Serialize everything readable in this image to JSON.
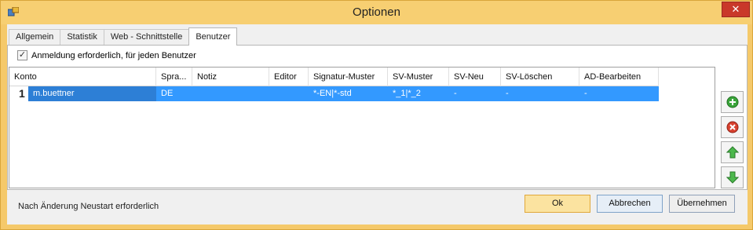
{
  "window": {
    "title": "Optionen",
    "close_glyph": "✕"
  },
  "tabs": [
    {
      "label": "Allgemein"
    },
    {
      "label": "Statistik"
    },
    {
      "label": "Web - Schnittstelle"
    },
    {
      "label": "Benutzer",
      "active": true
    }
  ],
  "login_required": {
    "label": "Anmeldung erforderlich, für jeden Benutzer",
    "checked": true,
    "check_glyph": "✓"
  },
  "grid": {
    "columns": [
      "Konto",
      "Spra...",
      "Notiz",
      "Editor",
      "Signatur-Muster",
      "SV-Muster",
      "SV-Neu",
      "SV-Löschen",
      "AD-Bearbeiten"
    ],
    "rows": [
      {
        "row_number": "1",
        "cells": [
          "m.buettner",
          "DE",
          "",
          "",
          "*-EN|*-std",
          "*_1|*_2",
          "-",
          "-",
          "-"
        ],
        "selected": true
      }
    ]
  },
  "side_buttons": [
    {
      "icon": "add-icon"
    },
    {
      "icon": "remove-icon"
    },
    {
      "icon": "arrow-up-icon"
    },
    {
      "icon": "arrow-down-icon"
    }
  ],
  "status_text": "Nach Änderung Neustart erforderlich",
  "buttons": {
    "ok": "Ok",
    "cancel": "Abbrechen",
    "apply": "Übernehmen"
  },
  "colors": {
    "titlebar": "#f7cf72",
    "selection": "#3399ff",
    "ok_button": "#fbe3a0"
  }
}
